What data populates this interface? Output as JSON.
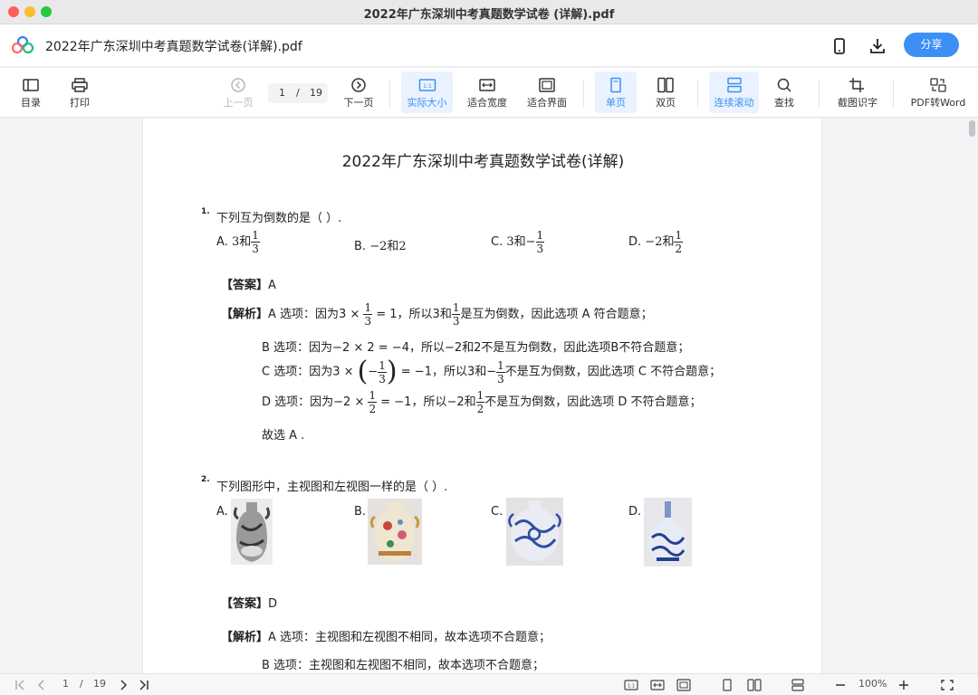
{
  "window": {
    "title": "2022年广东深圳中考真题数学试卷 (详解).pdf"
  },
  "appbar": {
    "doc_name": "2022年广东深圳中考真题数学试卷(详解).pdf",
    "share_label": "分享"
  },
  "toolbar": {
    "toc": "目录",
    "print": "打印",
    "prev": "上一页",
    "next": "下一页",
    "current_page": "1",
    "slash": "/",
    "total_pages": "19",
    "actual_size": "实际大小",
    "fit_width": "适合宽度",
    "fit_page": "适合界面",
    "single": "单页",
    "double": "双页",
    "continuous": "连续滚动",
    "find": "查找",
    "ocr": "截图识字",
    "to_word": "PDF转Word",
    "actual_badge": "1:1"
  },
  "doc": {
    "title": "2022年广东深圳中考真题数学试卷(详解)",
    "q1": {
      "num": "1.",
      "stem": "下列互为倒数的是（    ）.",
      "a_label": "A.",
      "a_text": "3和",
      "b_label": "B.",
      "b_text": "−2和2",
      "c_label": "C.",
      "c_text": "3和−",
      "d_label": "D.",
      "d_text": "−2和",
      "answer_head": "【答案】",
      "answer_val": "A",
      "analysis_head": "【解析】",
      "l1_pre": "A 选项：因为3 ×",
      "l1_mid": "= 1，所以3和",
      "l1_post": "是互为倒数，因此选项 A 符合题意；",
      "l2": "B 选项：因为−2 × 2 = −4，所以−2和2不是互为倒数，因此选项B不符合题意；",
      "l3_pre": "C 选项：因为3 ×",
      "l3_mid": "= −1，所以3和−",
      "l3_post": "不是互为倒数，因此选项 C 不符合题意；",
      "l4_pre": "D 选项：因为−2 ×",
      "l4_mid": "= −1，所以−2和",
      "l4_post": "不是互为倒数，因此选项 D 不符合题意；",
      "l5": "故选 A .",
      "one": "1",
      "three": "3",
      "two": "2",
      "minus": "−"
    },
    "q2": {
      "num": "2.",
      "stem": "下列图形中，主视图和左视图一样的是（    ）.",
      "a": "A.",
      "b": "B.",
      "c": "C.",
      "d": "D.",
      "answer_head": "【答案】",
      "answer_val": "D",
      "analysis_head": "【解析】",
      "l1": "A 选项：主视图和左视图不相同，故本选项不合题意；",
      "l2": "B 选项：主视图和左视图不相同，故本选项不合题意；"
    }
  },
  "statusbar": {
    "page": "1",
    "slash": "/",
    "total": "19",
    "zoom": "100%",
    "badge": "1:1"
  },
  "colors": {
    "accent": "#3d8ff5",
    "active_bg": "#e9f2fe"
  }
}
